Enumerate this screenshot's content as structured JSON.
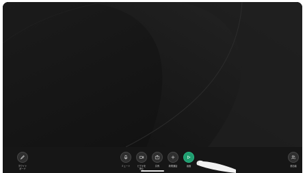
{
  "colors": {
    "background": "#161616",
    "toolbar_button": "#2e2e2e",
    "accent": "#1f9d6f"
  },
  "toolbar": {
    "whiteboard": {
      "icon": "pen-icon",
      "label_line1": "ホワイト",
      "label_line2": "ボード"
    },
    "mute": {
      "icon": "microphone-icon",
      "label": "ミュート"
    },
    "stop_video": {
      "icon": "video-camera-icon",
      "label_line1": "ビデオを",
      "label_line2": "停止"
    },
    "share": {
      "icon": "share-screen-icon",
      "label": "共有"
    },
    "new_meeting": {
      "icon": "plus-icon",
      "label": "新規通話"
    },
    "present": {
      "icon": "cast-icon",
      "label": "画面"
    },
    "participants": {
      "icon": "participants-icon",
      "label": "参加者"
    }
  }
}
